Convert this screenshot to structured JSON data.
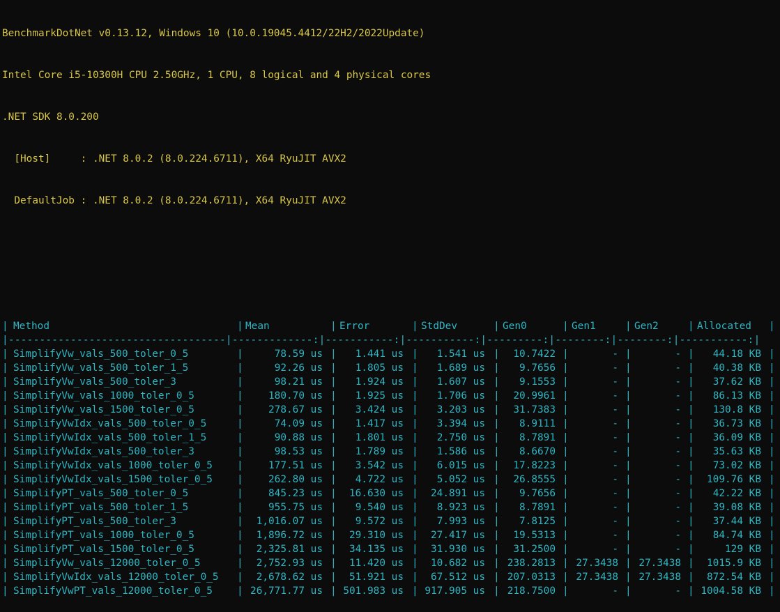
{
  "header": {
    "line1": "BenchmarkDotNet v0.13.12, Windows 10 (10.0.19045.4412/22H2/2022Update)",
    "line2": "Intel Core i5-10300H CPU 2.50GHz, 1 CPU, 8 logical and 4 physical cores",
    "line3": ".NET SDK 8.0.200",
    "line4": "  [Host]     : .NET 8.0.2 (8.0.224.6711), X64 RyuJIT AVX2",
    "line5": "  DefaultJob : .NET 8.0.2 (8.0.224.6711), X64 RyuJIT AVX2"
  },
  "table": {
    "columns": [
      "Method",
      "Mean",
      "Error",
      "StdDev",
      "Gen0",
      "Gen1",
      "Gen2",
      "Allocated"
    ],
    "separator_line": "|-----------------------------------|-------------:|-----------:|-----------:|---------:|--------:|--------:|-----------:|",
    "rows": [
      [
        "SimplifyVw_vals_500_toler_0_5",
        "78.59 us",
        "1.441 us",
        "1.541 us",
        "10.7422",
        "-",
        "-",
        "44.18 KB"
      ],
      [
        "SimplifyVw_vals_500_toler_1_5",
        "92.26 us",
        "1.805 us",
        "1.689 us",
        "9.7656",
        "-",
        "-",
        "40.38 KB"
      ],
      [
        "SimplifyVw_vals_500_toler_3",
        "98.21 us",
        "1.924 us",
        "1.607 us",
        "9.1553",
        "-",
        "-",
        "37.62 KB"
      ],
      [
        "SimplifyVw_vals_1000_toler_0_5",
        "180.70 us",
        "1.925 us",
        "1.706 us",
        "20.9961",
        "-",
        "-",
        "86.13 KB"
      ],
      [
        "SimplifyVw_vals_1500_toler_0_5",
        "278.67 us",
        "3.424 us",
        "3.203 us",
        "31.7383",
        "-",
        "-",
        "130.8 KB"
      ],
      [
        "SimplifyVwIdx_vals_500_toler_0_5",
        "74.09 us",
        "1.417 us",
        "3.394 us",
        "8.9111",
        "-",
        "-",
        "36.73 KB"
      ],
      [
        "SimplifyVwIdx_vals_500_toler_1_5",
        "90.88 us",
        "1.801 us",
        "2.750 us",
        "8.7891",
        "-",
        "-",
        "36.09 KB"
      ],
      [
        "SimplifyVwIdx_vals_500_toler_3",
        "98.53 us",
        "1.789 us",
        "1.586 us",
        "8.6670",
        "-",
        "-",
        "35.63 KB"
      ],
      [
        "SimplifyVwIdx_vals_1000_toler_0_5",
        "177.51 us",
        "3.542 us",
        "6.015 us",
        "17.8223",
        "-",
        "-",
        "73.02 KB"
      ],
      [
        "SimplifyVwIdx_vals_1500_toler_0_5",
        "262.80 us",
        "4.722 us",
        "5.052 us",
        "26.8555",
        "-",
        "-",
        "109.76 KB"
      ],
      [
        "SimplifyPT_vals_500_toler_0_5",
        "845.23 us",
        "16.630 us",
        "24.891 us",
        "9.7656",
        "-",
        "-",
        "42.22 KB"
      ],
      [
        "SimplifyPT_vals_500_toler_1_5",
        "955.75 us",
        "9.540 us",
        "8.923 us",
        "8.7891",
        "-",
        "-",
        "39.08 KB"
      ],
      [
        "SimplifyPT_vals_500_toler_3",
        "1,016.07 us",
        "9.572 us",
        "7.993 us",
        "7.8125",
        "-",
        "-",
        "37.44 KB"
      ],
      [
        "SimplifyPT_vals_1000_toler_0_5",
        "1,896.72 us",
        "29.310 us",
        "27.417 us",
        "19.5313",
        "-",
        "-",
        "84.74 KB"
      ],
      [
        "SimplifyPT_vals_1500_toler_0_5",
        "2,325.81 us",
        "34.135 us",
        "31.930 us",
        "31.2500",
        "-",
        "-",
        "129 KB"
      ],
      [
        "SimplifyVw_vals_12000_toler_0_5",
        "2,752.93 us",
        "11.420 us",
        "10.682 us",
        "238.2813",
        "27.3438",
        "27.3438",
        "1015.9 KB"
      ],
      [
        "SimplifyVwIdx_vals_12000_toler_0_5",
        "2,678.62 us",
        "51.921 us",
        "67.512 us",
        "207.0313",
        "27.3438",
        "27.3438",
        "872.54 KB"
      ],
      [
        "SimplifyVwPT_vals_12000_toler_0_5",
        "26,771.77 us",
        "501.983 us",
        "917.905 us",
        "218.7500",
        "-",
        "-",
        "1004.58 KB"
      ]
    ]
  },
  "colors": {
    "background": "#0c0c0c",
    "header_text": "#d7c64a",
    "table_text": "#2fb5c2"
  }
}
